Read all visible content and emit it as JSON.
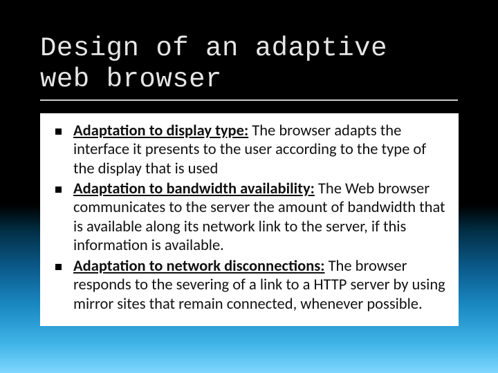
{
  "title": "Design of an adaptive\nweb browser",
  "bullets": [
    {
      "lead": "Adaptation to display type:",
      "body": " The browser adapts the interface it presents to the user according to the type of the display that is used"
    },
    {
      "lead": "Adaptation to bandwidth availability:",
      "body": " The Web browser communicates to the server the amount of bandwidth that is available along its network link to the server, if this information is available."
    },
    {
      "lead": "Adaptation to network disconnections:",
      "body": " The browser responds to the severing of a link to a HTTP server by using mirror sites that remain connected, whenever possible."
    }
  ]
}
